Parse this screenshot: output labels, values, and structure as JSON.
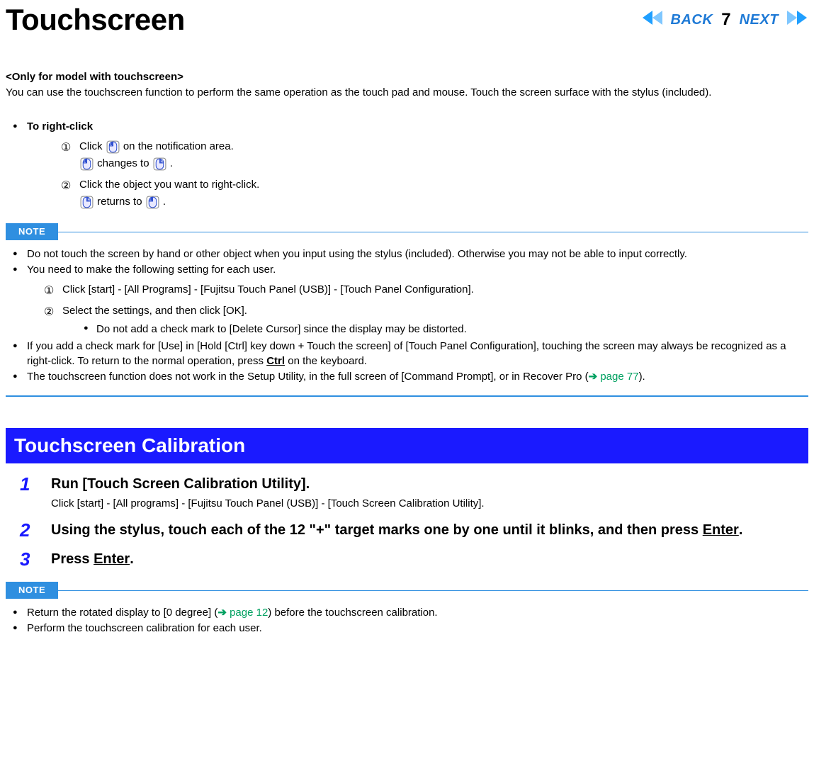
{
  "header": {
    "title": "Touchscreen",
    "back": "BACK",
    "next": "NEXT",
    "page_number": "7"
  },
  "intro": {
    "subtitle": "<Only for model with touchscreen>",
    "text": "You can use the touchscreen function to perform the same operation as the touch pad and mouse. Touch the screen surface with the stylus (included)."
  },
  "right_click": {
    "heading": "To right-click",
    "step1_a": "Click ",
    "step1_b": " on the notification area.",
    "step1_changes_a": " changes to ",
    "step1_changes_b": ".",
    "step2": "Click the object you want to right-click.",
    "step2_returns_a": " returns to ",
    "step2_returns_b": "."
  },
  "note1": {
    "label": "NOTE",
    "items": [
      "Do not touch the screen by hand or other object when you input using the stylus (included). Otherwise you may not be able to input correctly.",
      "You need to make the following setting for each user."
    ],
    "sub_steps": {
      "s1": "Click [start] - [All Programs] - [Fujitsu Touch Panel (USB)] - [Touch Panel Configuration].",
      "s2": "Select the settings, and then click [OK].",
      "s2_sub": "Do not add a check mark to [Delete Cursor] since the display may be distorted."
    },
    "item3_a": "If you add a check mark for [Use] in [Hold [Ctrl] key down + Touch the screen] of [Touch Panel Configuration], touching the screen may always be recognized as a right-click. To return to the normal operation, press ",
    "item3_key": "Ctrl",
    "item3_b": " on the keyboard.",
    "item4_a": "The touchscreen function does not work in the Setup Utility, in the full screen of [Command Prompt], or in Recover Pro (",
    "item4_link": " page 77",
    "item4_b": ")."
  },
  "calibration": {
    "band": "Touchscreen Calibration",
    "steps": [
      {
        "num": "1",
        "title": "Run [Touch Screen Calibration Utility].",
        "sub": "Click [start] - [All programs] - [Fujitsu Touch Panel (USB)] - [Touch Screen Calibration Utility]."
      },
      {
        "num": "2",
        "title_a": "Using the stylus, touch each of the 12 \"+\" target marks one by one until it blinks, and then press ",
        "title_key": "Enter",
        "title_b": "."
      },
      {
        "num": "3",
        "title_a": "Press ",
        "title_key": "Enter",
        "title_b": "."
      }
    ]
  },
  "note2": {
    "label": "NOTE",
    "item1_a": "Return the rotated display to [0 degree] (",
    "item1_link": " page 12",
    "item1_b": ") before the touchscreen calibration.",
    "item2": "Perform the touchscreen calibration for each user."
  }
}
